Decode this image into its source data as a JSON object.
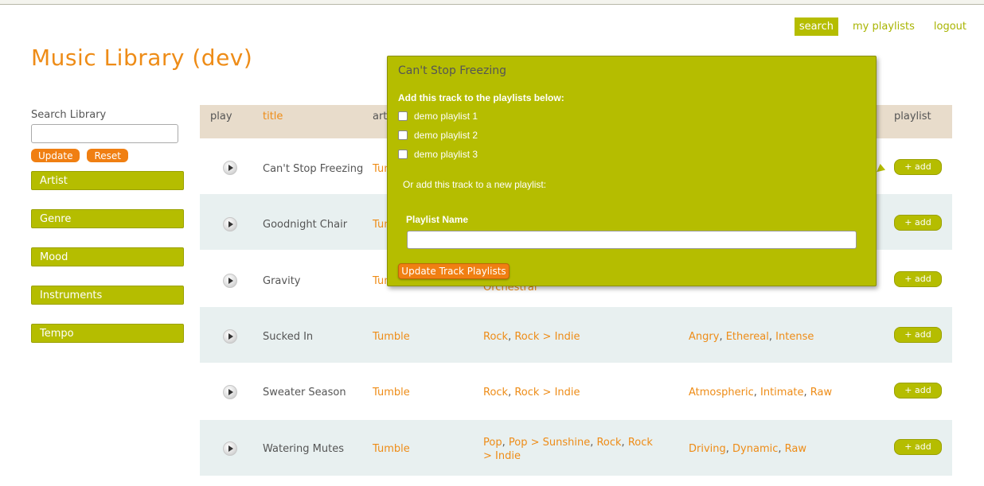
{
  "nav": {
    "items": [
      {
        "label": "search"
      },
      {
        "label": "my playlists"
      },
      {
        "label": "logout"
      }
    ]
  },
  "site": {
    "title": "Music Library (dev)"
  },
  "sidebar": {
    "search_label": "Search Library",
    "search_value": "",
    "update_label": "Update",
    "reset_label": "Reset",
    "facets": [
      {
        "label": "Artist"
      },
      {
        "label": "Genre"
      },
      {
        "label": "Mood"
      },
      {
        "label": "Instruments"
      },
      {
        "label": "Tempo"
      }
    ]
  },
  "table": {
    "headers": {
      "play": "play",
      "title": "title",
      "artist": "art",
      "playlist": "playlist"
    },
    "add_label": "+ add",
    "rows": [
      {
        "title": "Can't Stop Freezing",
        "artist": "Tumb",
        "genre": [],
        "mood": []
      },
      {
        "title": "Goodnight Chair",
        "artist": "Tum",
        "genre": [],
        "mood": []
      },
      {
        "title": "Gravity",
        "artist": "Tum",
        "genre": [
          "Orchestral"
        ],
        "mood": []
      },
      {
        "title": "Sucked In",
        "artist": "Tumble",
        "genre": [
          "Rock",
          "Rock > Indie"
        ],
        "mood": [
          "Angry",
          "Ethereal",
          "Intense"
        ]
      },
      {
        "title": "Sweater Season",
        "artist": "Tumble",
        "genre": [
          "Rock",
          "Rock > Indie"
        ],
        "mood": [
          "Atmospheric",
          "Intimate",
          "Raw"
        ]
      },
      {
        "title": "Watering Mutes",
        "artist": "Tumble",
        "genre": [
          "Pop",
          "Pop > Sunshine",
          "Rock",
          "Rock > Indie"
        ],
        "mood": [
          "Driving",
          "Dynamic",
          "Raw"
        ]
      }
    ]
  },
  "popup": {
    "title": "Can't Stop Freezing",
    "subtitle": "Add this track to the playlists below:",
    "playlists": [
      {
        "label": "demo playlist 1",
        "checked": false
      },
      {
        "label": "demo playlist 2",
        "checked": false
      },
      {
        "label": "demo playlist 3",
        "checked": false
      }
    ],
    "or_text": "Or add this track to a new playlist:",
    "name_label": "Playlist Name",
    "name_value": "",
    "submit_label": "Update Track Playlists"
  },
  "colors": {
    "accent_green": "#b5bd00",
    "accent_orange": "#ee8c17",
    "header_bg": "#e8dccb",
    "row_alt_bg": "#e8f0f0"
  }
}
